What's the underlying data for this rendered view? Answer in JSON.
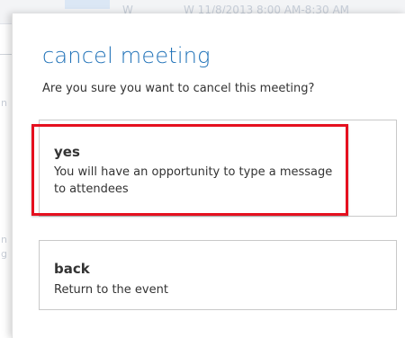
{
  "background": {
    "header_fragment_left": "W",
    "header_fragment_right": "W  11/8/2013 8:00 AM-8:30 AM"
  },
  "dialog": {
    "title": "cancel meeting",
    "question": "Are you sure you want to cancel this meeting?",
    "options": [
      {
        "label": "yes",
        "description": "You will have an opportunity to type a message to attendees"
      },
      {
        "label": "back",
        "description": "Return to the event"
      }
    ]
  },
  "colors": {
    "title": "#2072b8",
    "highlight": "#e5101f",
    "border": "#c9c9c9"
  }
}
